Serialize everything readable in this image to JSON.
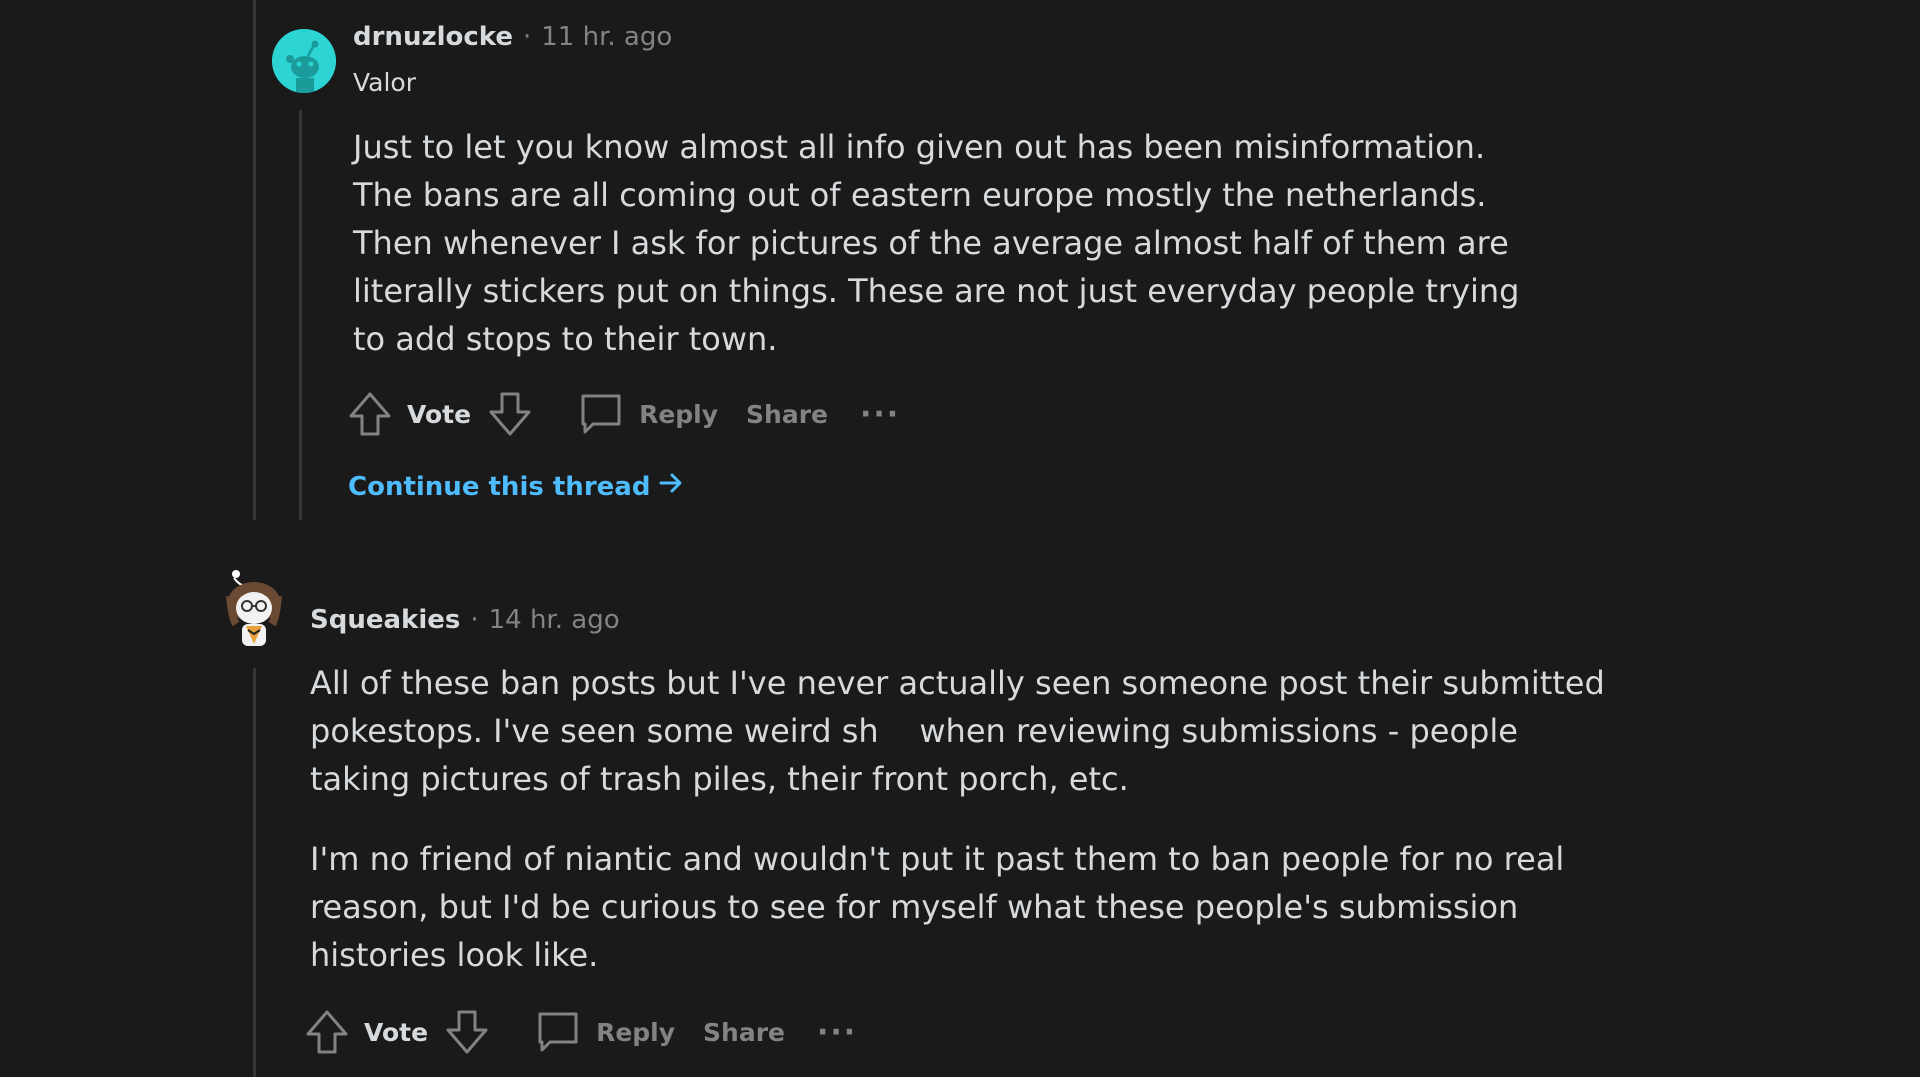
{
  "comments": [
    {
      "author": "drnuzlocke",
      "time": "11 hr. ago",
      "flair": "Valor",
      "paragraphs": [
        "Just to let you know almost all info given out has been misinformation. The bans are all coming out of eastern europe mostly the netherlands. Then whenever I ask for pictures of the average almost half of them are literally stickers put on things. These are not just everyday people trying to add stops to their town."
      ],
      "actions": {
        "vote": "Vote",
        "reply": "Reply",
        "share": "Share",
        "more": "···"
      },
      "continue_label": "Continue this thread"
    },
    {
      "author": "Squeakies",
      "time": "14 hr. ago",
      "paragraphs": [
        "All of these ban posts but I've never actually seen someone post their submitted pokestops. I've seen some weird sh    when reviewing submissions - people taking pictures of trash piles, their front porch, etc.",
        "I'm no friend of niantic and wouldn't put it past them to ban people for no real reason, but I'd be curious to see for myself what these people's submission histories look like."
      ],
      "actions": {
        "vote": "Vote",
        "reply": "Reply",
        "share": "Share",
        "more": "···"
      }
    }
  ],
  "colors": {
    "background": "#1a1a1b",
    "text": "#d7dadc",
    "muted": "#818384",
    "link": "#4fbcff",
    "thread_line": "#343536",
    "avatar1": "#2dd4d4"
  },
  "icons": [
    "upvote-icon",
    "downvote-icon",
    "comment-icon",
    "arrow-right-icon",
    "more-icon"
  ]
}
